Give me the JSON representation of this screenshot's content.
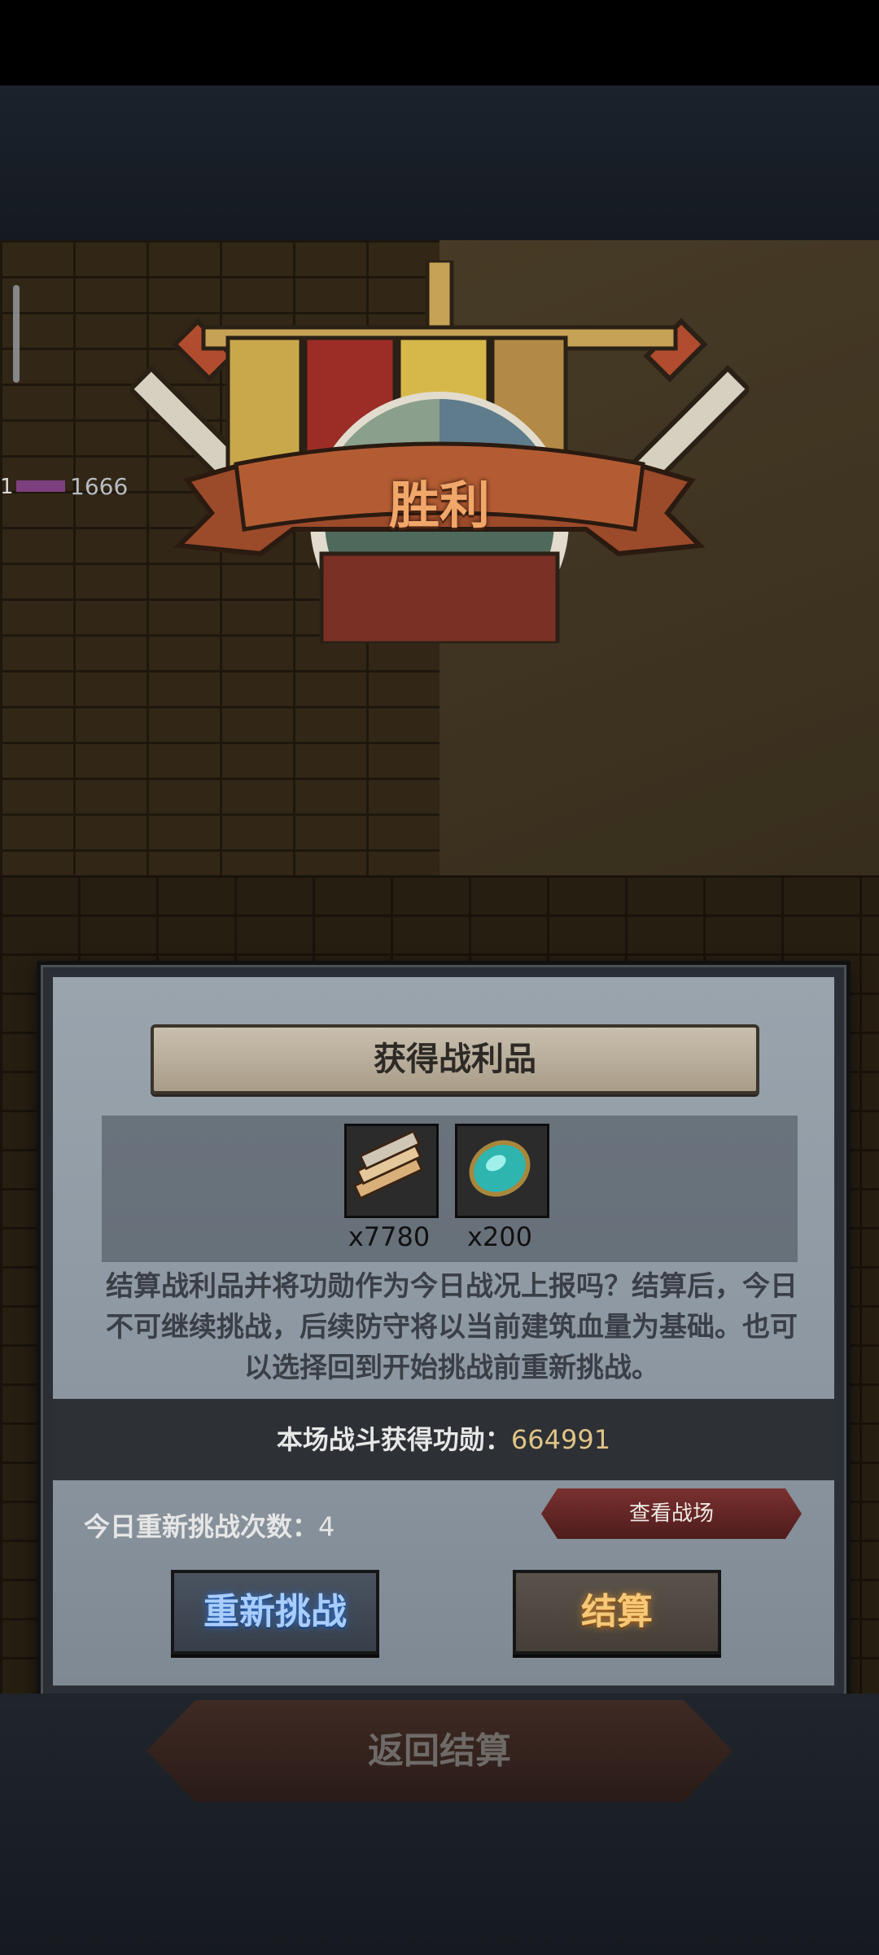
{
  "scene": {
    "unit_level": "1",
    "unit_hp": "1666"
  },
  "emblem": {
    "title": "胜利"
  },
  "panel": {
    "title": "获得战利品",
    "loot": [
      {
        "icon": "wood-planks-icon",
        "count": "x7780"
      },
      {
        "icon": "turquoise-gem-icon",
        "count": "x200"
      }
    ],
    "description": "结算战利品并将功勋作为今日战况上报吗？结算后，今日不可继续挑战，后续防守将以当前建筑血量为基础。也可以选择回到开始挑战前重新挑战。",
    "merit_label": "本场战斗获得功勋：",
    "merit_value": "664991",
    "retry_label": "今日重新挑战次数：",
    "retry_value": "4",
    "view_battlefield": "查看战场",
    "retry_button": "重新挑战",
    "settle_button": "结算"
  },
  "bottom": {
    "back_button": "返回结算"
  },
  "colors": {
    "victory_text": "#f1a76a",
    "merit_value": "#e0c486",
    "retry_button_text": "#a9cdfc",
    "settle_button_text": "#f6c877"
  }
}
